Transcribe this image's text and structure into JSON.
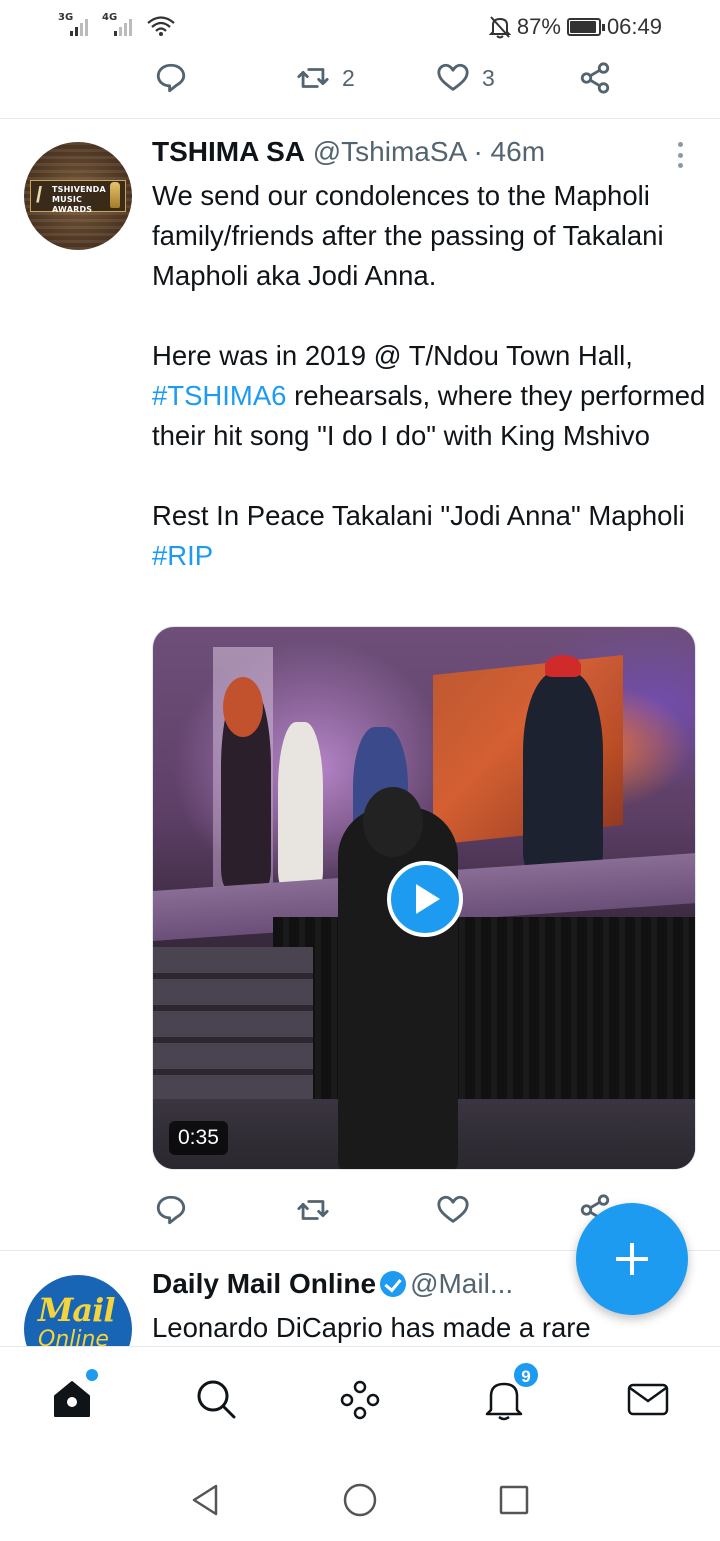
{
  "status_bar": {
    "network1": "3G",
    "network2": "4G",
    "battery": "87%",
    "battery_level": 0.87,
    "time": "06:49"
  },
  "prev_tweet_actions": {
    "reply_count": "",
    "retweet_count": "2",
    "like_count": "3"
  },
  "tweet": {
    "author_name": "TSHIMA SA",
    "author_handle": "@TshimaSA",
    "time": "· 46m",
    "avatar_text": "TSHIVENDA MUSIC AWARDS",
    "p1": "We send our condolences to the Mapholi family/friends after the passing of Takalani Mapholi aka Jodi Anna.",
    "p2_before": "Here was in 2019 @ T/Ndou Town Hall, ",
    "p2_hashtag": "#TSHIMA6",
    "p2_after": " rehearsals, where they performed their hit song \"I do I do\" with King Mshivo",
    "p3_before": "Rest In Peace Takalani \"Jodi Anna\" Mapholi ",
    "p3_hashtag": "#RIP",
    "video_duration": "0:35"
  },
  "next_tweet": {
    "author_name": "Daily Mail Online",
    "author_handle": "@Mail...",
    "avatar_text_1": "Mail",
    "avatar_text_2": "Online",
    "text": "Leonardo DiCaprio has made a rare"
  },
  "bottom_nav": {
    "notifications_badge": "9"
  },
  "colors": {
    "accent": "#1d9bf0",
    "text_primary": "#0f1419",
    "text_secondary": "#536471"
  }
}
